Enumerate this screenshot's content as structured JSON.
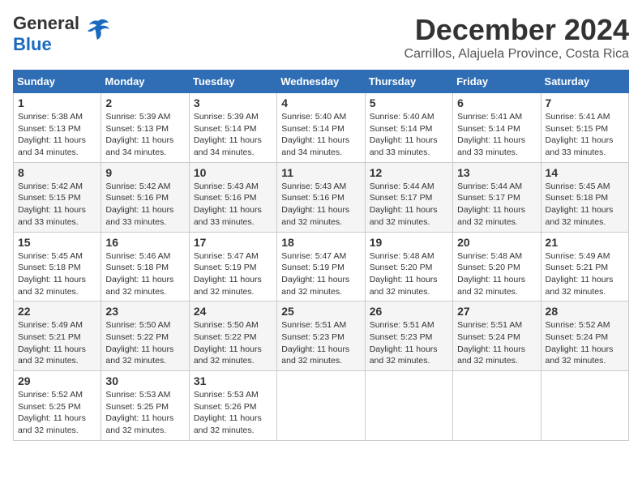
{
  "logo": {
    "general": "General",
    "blue": "Blue"
  },
  "title": "December 2024",
  "subtitle": "Carrillos, Alajuela Province, Costa Rica",
  "days_header": [
    "Sunday",
    "Monday",
    "Tuesday",
    "Wednesday",
    "Thursday",
    "Friday",
    "Saturday"
  ],
  "weeks": [
    [
      {
        "day": "1",
        "sunrise": "5:38 AM",
        "sunset": "5:13 PM",
        "daylight": "11 hours and 34 minutes."
      },
      {
        "day": "2",
        "sunrise": "5:39 AM",
        "sunset": "5:13 PM",
        "daylight": "11 hours and 34 minutes."
      },
      {
        "day": "3",
        "sunrise": "5:39 AM",
        "sunset": "5:14 PM",
        "daylight": "11 hours and 34 minutes."
      },
      {
        "day": "4",
        "sunrise": "5:40 AM",
        "sunset": "5:14 PM",
        "daylight": "11 hours and 34 minutes."
      },
      {
        "day": "5",
        "sunrise": "5:40 AM",
        "sunset": "5:14 PM",
        "daylight": "11 hours and 33 minutes."
      },
      {
        "day": "6",
        "sunrise": "5:41 AM",
        "sunset": "5:14 PM",
        "daylight": "11 hours and 33 minutes."
      },
      {
        "day": "7",
        "sunrise": "5:41 AM",
        "sunset": "5:15 PM",
        "daylight": "11 hours and 33 minutes."
      }
    ],
    [
      {
        "day": "8",
        "sunrise": "5:42 AM",
        "sunset": "5:15 PM",
        "daylight": "11 hours and 33 minutes."
      },
      {
        "day": "9",
        "sunrise": "5:42 AM",
        "sunset": "5:16 PM",
        "daylight": "11 hours and 33 minutes."
      },
      {
        "day": "10",
        "sunrise": "5:43 AM",
        "sunset": "5:16 PM",
        "daylight": "11 hours and 33 minutes."
      },
      {
        "day": "11",
        "sunrise": "5:43 AM",
        "sunset": "5:16 PM",
        "daylight": "11 hours and 32 minutes."
      },
      {
        "day": "12",
        "sunrise": "5:44 AM",
        "sunset": "5:17 PM",
        "daylight": "11 hours and 32 minutes."
      },
      {
        "day": "13",
        "sunrise": "5:44 AM",
        "sunset": "5:17 PM",
        "daylight": "11 hours and 32 minutes."
      },
      {
        "day": "14",
        "sunrise": "5:45 AM",
        "sunset": "5:18 PM",
        "daylight": "11 hours and 32 minutes."
      }
    ],
    [
      {
        "day": "15",
        "sunrise": "5:45 AM",
        "sunset": "5:18 PM",
        "daylight": "11 hours and 32 minutes."
      },
      {
        "day": "16",
        "sunrise": "5:46 AM",
        "sunset": "5:18 PM",
        "daylight": "11 hours and 32 minutes."
      },
      {
        "day": "17",
        "sunrise": "5:47 AM",
        "sunset": "5:19 PM",
        "daylight": "11 hours and 32 minutes."
      },
      {
        "day": "18",
        "sunrise": "5:47 AM",
        "sunset": "5:19 PM",
        "daylight": "11 hours and 32 minutes."
      },
      {
        "day": "19",
        "sunrise": "5:48 AM",
        "sunset": "5:20 PM",
        "daylight": "11 hours and 32 minutes."
      },
      {
        "day": "20",
        "sunrise": "5:48 AM",
        "sunset": "5:20 PM",
        "daylight": "11 hours and 32 minutes."
      },
      {
        "day": "21",
        "sunrise": "5:49 AM",
        "sunset": "5:21 PM",
        "daylight": "11 hours and 32 minutes."
      }
    ],
    [
      {
        "day": "22",
        "sunrise": "5:49 AM",
        "sunset": "5:21 PM",
        "daylight": "11 hours and 32 minutes."
      },
      {
        "day": "23",
        "sunrise": "5:50 AM",
        "sunset": "5:22 PM",
        "daylight": "11 hours and 32 minutes."
      },
      {
        "day": "24",
        "sunrise": "5:50 AM",
        "sunset": "5:22 PM",
        "daylight": "11 hours and 32 minutes."
      },
      {
        "day": "25",
        "sunrise": "5:51 AM",
        "sunset": "5:23 PM",
        "daylight": "11 hours and 32 minutes."
      },
      {
        "day": "26",
        "sunrise": "5:51 AM",
        "sunset": "5:23 PM",
        "daylight": "11 hours and 32 minutes."
      },
      {
        "day": "27",
        "sunrise": "5:51 AM",
        "sunset": "5:24 PM",
        "daylight": "11 hours and 32 minutes."
      },
      {
        "day": "28",
        "sunrise": "5:52 AM",
        "sunset": "5:24 PM",
        "daylight": "11 hours and 32 minutes."
      }
    ],
    [
      {
        "day": "29",
        "sunrise": "5:52 AM",
        "sunset": "5:25 PM",
        "daylight": "11 hours and 32 minutes."
      },
      {
        "day": "30",
        "sunrise": "5:53 AM",
        "sunset": "5:25 PM",
        "daylight": "11 hours and 32 minutes."
      },
      {
        "day": "31",
        "sunrise": "5:53 AM",
        "sunset": "5:26 PM",
        "daylight": "11 hours and 32 minutes."
      },
      null,
      null,
      null,
      null
    ]
  ],
  "labels": {
    "sunrise": "Sunrise:",
    "sunset": "Sunset:",
    "daylight": "Daylight:"
  }
}
